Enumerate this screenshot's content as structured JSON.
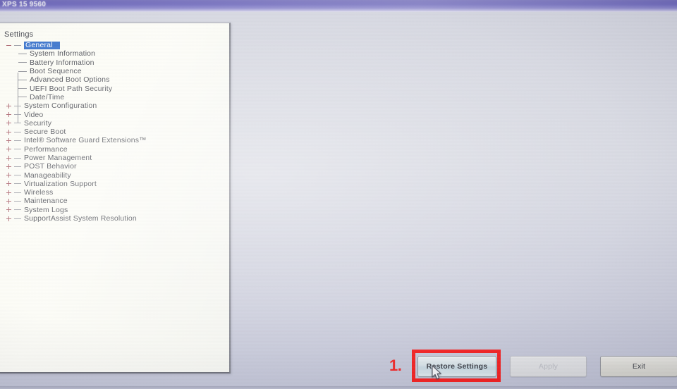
{
  "window": {
    "title": "XPS 15 9560"
  },
  "tree": {
    "header": "Settings",
    "items": [
      {
        "label": "General",
        "level": 1,
        "state": "expanded",
        "selected": true
      },
      {
        "label": "System Information",
        "level": 2,
        "state": "leaf",
        "selected": false
      },
      {
        "label": "Battery Information",
        "level": 2,
        "state": "leaf",
        "selected": false
      },
      {
        "label": "Boot Sequence",
        "level": 2,
        "state": "leaf",
        "selected": false
      },
      {
        "label": "Advanced Boot Options",
        "level": 2,
        "state": "leaf",
        "selected": false
      },
      {
        "label": "UEFI Boot Path Security",
        "level": 2,
        "state": "leaf",
        "selected": false
      },
      {
        "label": "Date/Time",
        "level": 2,
        "state": "leaf",
        "selected": false
      },
      {
        "label": "System Configuration",
        "level": 1,
        "state": "collapsed",
        "selected": false
      },
      {
        "label": "Video",
        "level": 1,
        "state": "collapsed",
        "selected": false
      },
      {
        "label": "Security",
        "level": 1,
        "state": "collapsed",
        "selected": false
      },
      {
        "label": "Secure Boot",
        "level": 1,
        "state": "collapsed",
        "selected": false
      },
      {
        "label": "Intel® Software Guard Extensions™",
        "level": 1,
        "state": "collapsed",
        "selected": false
      },
      {
        "label": "Performance",
        "level": 1,
        "state": "collapsed",
        "selected": false
      },
      {
        "label": "Power Management",
        "level": 1,
        "state": "collapsed",
        "selected": false
      },
      {
        "label": "POST Behavior",
        "level": 1,
        "state": "collapsed",
        "selected": false
      },
      {
        "label": "Manageability",
        "level": 1,
        "state": "collapsed",
        "selected": false
      },
      {
        "label": "Virtualization Support",
        "level": 1,
        "state": "collapsed",
        "selected": false
      },
      {
        "label": "Wireless",
        "level": 1,
        "state": "collapsed",
        "selected": false
      },
      {
        "label": "Maintenance",
        "level": 1,
        "state": "collapsed",
        "selected": false
      },
      {
        "label": "System Logs",
        "level": 1,
        "state": "collapsed",
        "selected": false
      },
      {
        "label": "SupportAssist System Resolution",
        "level": 1,
        "state": "collapsed",
        "selected": false
      }
    ]
  },
  "buttons": {
    "restore": "Restore Settings",
    "apply": "Apply",
    "exit": "Exit"
  },
  "annotation": {
    "step_number": "1.",
    "color": "#ef0a0a",
    "targets": "Restore Settings"
  },
  "colors": {
    "titlebar_accent": "#4f48ab",
    "selection_blue": "#1e5fc4",
    "annotation_red": "#ef0a0a",
    "panel_background": "#fbfbf3",
    "screen_background": "#cfd1dc"
  },
  "icons": {
    "expander_expanded": "minus-square-icon",
    "expander_collapsed": "plus-square-icon",
    "pointer": "mouse-arrow-cursor-icon"
  }
}
